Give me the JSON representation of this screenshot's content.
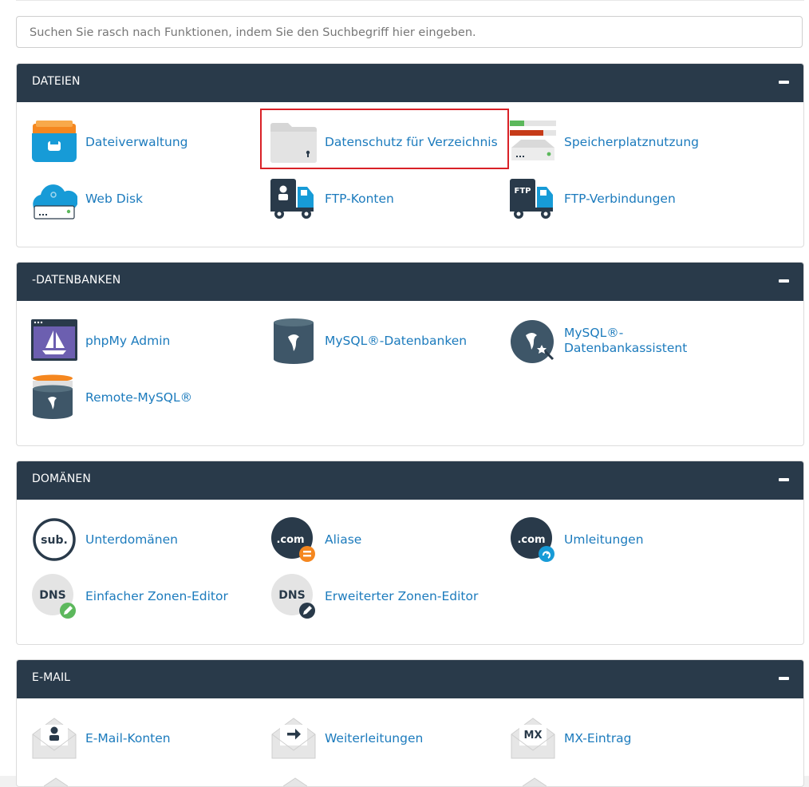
{
  "search": {
    "placeholder": "Suchen Sie rasch nach Funktionen, indem Sie den Suchbegriff hier eingeben.",
    "value": ""
  },
  "sections": [
    {
      "title": "DATEIEN",
      "items": [
        {
          "label": "Dateiverwaltung",
          "icon": "file-manager-icon"
        },
        {
          "label": "Datenschutz für Verzeichnis",
          "icon": "directory-privacy-icon",
          "highlighted": true
        },
        {
          "label": "Speicherplatznutzung",
          "icon": "disk-usage-icon"
        },
        {
          "label": "Web Disk",
          "icon": "web-disk-icon"
        },
        {
          "label": "FTP-Konten",
          "icon": "ftp-accounts-icon"
        },
        {
          "label": "FTP-Verbindungen",
          "icon": "ftp-connections-icon"
        }
      ]
    },
    {
      "title": "-DATENBANKEN",
      "items": [
        {
          "label": "phpMy Admin",
          "icon": "phpmyadmin-icon"
        },
        {
          "label": "MySQL®-Datenbanken",
          "icon": "mysql-databases-icon"
        },
        {
          "label": "MySQL®-",
          "label2": "Datenbankassistent",
          "icon": "mysql-wizard-icon"
        },
        {
          "label": "Remote-MySQL®",
          "icon": "remote-mysql-icon"
        }
      ]
    },
    {
      "title": "DOMÄNEN",
      "items": [
        {
          "label": "Unterdomänen",
          "icon": "subdomains-icon",
          "badge": "sub."
        },
        {
          "label": "Aliase",
          "icon": "aliases-icon",
          "badge": ".com"
        },
        {
          "label": "Umleitungen",
          "icon": "redirects-icon",
          "badge": ".com"
        },
        {
          "label": "Einfacher Zonen-Editor",
          "icon": "simple-zone-editor-icon",
          "badge": "DNS"
        },
        {
          "label": "Erweiterter Zonen-Editor",
          "icon": "advanced-zone-editor-icon",
          "badge": "DNS"
        }
      ]
    },
    {
      "title": "E-MAIL",
      "items": [
        {
          "label": "E-Mail-Konten",
          "icon": "email-accounts-icon"
        },
        {
          "label": "Weiterleitungen",
          "icon": "forwarders-icon"
        },
        {
          "label": "MX-Eintrag",
          "icon": "mx-entry-icon",
          "badge": "MX"
        }
      ]
    }
  ],
  "colors": {
    "header": "#293a4a",
    "link": "#1c7bbd",
    "highlight": "#d92127",
    "icon_dark": "#293a4a",
    "icon_blue": "#179bd7",
    "icon_orange": "#f5871f",
    "icon_green": "#5cb85c"
  }
}
